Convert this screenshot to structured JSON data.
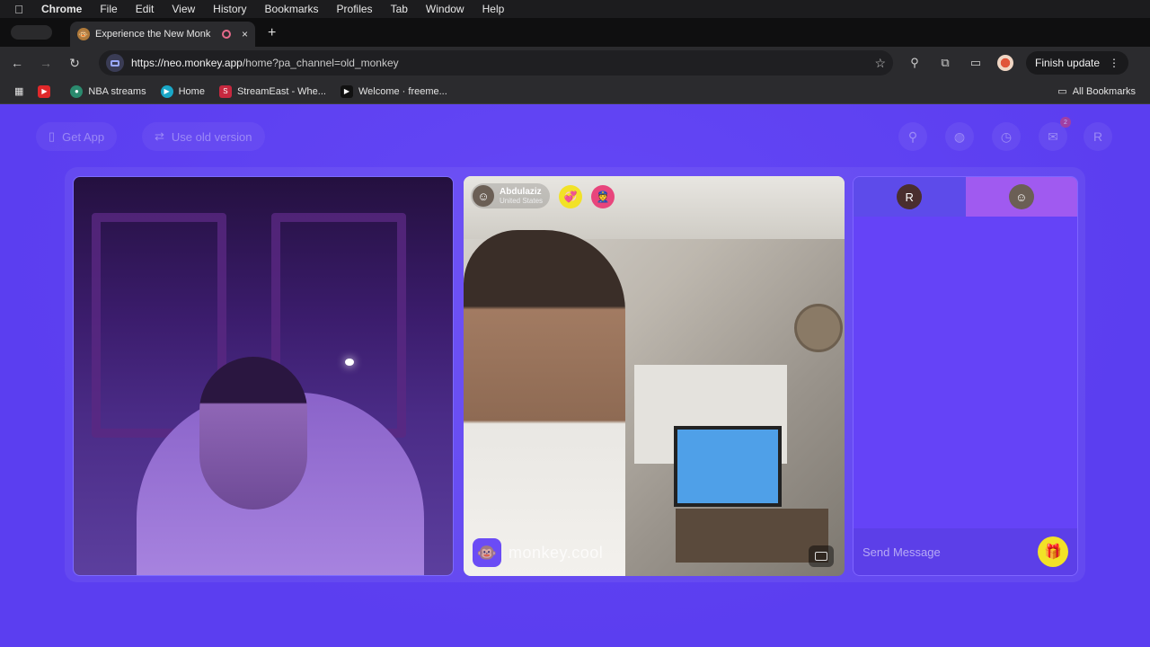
{
  "menubar": {
    "app": "Chrome",
    "items": [
      "File",
      "Edit",
      "View",
      "History",
      "Bookmarks",
      "Profiles",
      "Tab",
      "Window",
      "Help"
    ]
  },
  "tab": {
    "title": "Experience the New Monk",
    "close": "×",
    "new_tab": "+"
  },
  "toolbar": {
    "url_host": "https://neo.monkey.app",
    "url_path": "/home?pa_channel=old_monkey",
    "finish_update": "Finish update"
  },
  "bookmarks": {
    "items": [
      {
        "label": "",
        "icon": "youtube-icon",
        "color": "#e0282a"
      },
      {
        "label": "NBA streams",
        "icon": "nba-icon",
        "color": "#2b8a6e"
      },
      {
        "label": "Home",
        "icon": "play-icon",
        "color": "#19a7c7"
      },
      {
        "label": "StreamEast - Whe...",
        "icon": "s-icon",
        "color": "#c7283f"
      },
      {
        "label": "Welcome · freeme...",
        "icon": "play-icon",
        "color": "#111111"
      }
    ],
    "all": "All Bookmarks"
  },
  "page": {
    "get_app": "Get App",
    "use_old": "Use old version",
    "profile_initial": "R",
    "messages_badge": "2",
    "colors": {
      "bg": "#5b3ef0",
      "accent": "#f2e227"
    }
  },
  "remote_user": {
    "name": "Abdulaziz",
    "country": "United States"
  },
  "watermark": "monkey.cool",
  "chat": {
    "tab_a_initial": "R",
    "send_placeholder": "Send Message"
  }
}
